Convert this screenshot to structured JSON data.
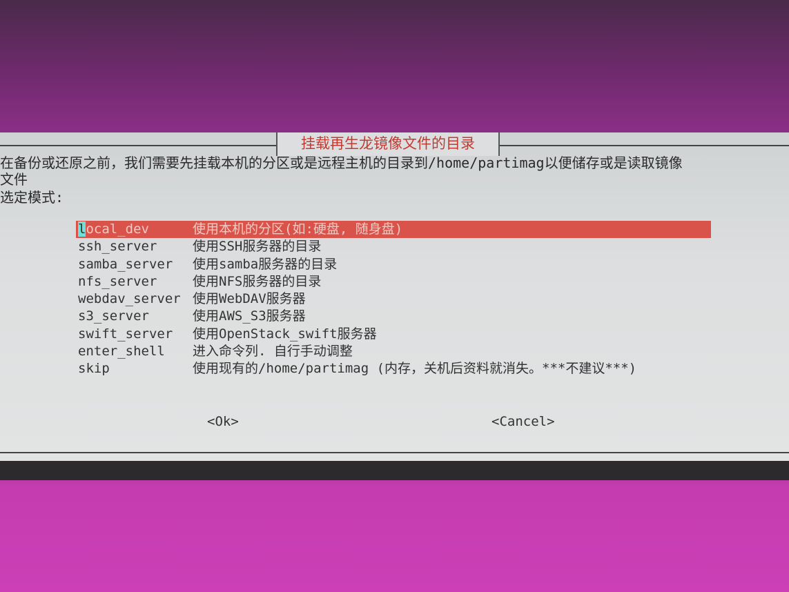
{
  "dialog": {
    "title": "挂载再生龙镜像文件的目录",
    "description_line1": "在备份或还原之前，我们需要先挂载本机的分区或是远程主机的目录到/home/partimag以便储存或是读取镜像",
    "description_line2": "文件",
    "prompt": "选定模式:",
    "options": [
      {
        "tag": "local_dev",
        "desc": "使用本机的分区(如:硬盘, 随身盘)",
        "selected": true
      },
      {
        "tag": "ssh_server",
        "desc": "使用SSH服务器的目录"
      },
      {
        "tag": "samba_server",
        "desc": "使用samba服务器的目录"
      },
      {
        "tag": "nfs_server",
        "desc": "使用NFS服务器的目录"
      },
      {
        "tag": "webdav_server",
        "desc": "使用WebDAV服务器"
      },
      {
        "tag": "s3_server",
        "desc": "使用AWS_S3服务器"
      },
      {
        "tag": "swift_server",
        "desc": "使用OpenStack_swift服务器"
      },
      {
        "tag": "enter_shell",
        "desc": "进入命令列. 自行手动调整"
      },
      {
        "tag": "skip",
        "desc": "使用现有的/home/partimag (内存，关机后资料就消失。***不建议***)"
      }
    ],
    "ok_label": "<Ok>",
    "cancel_label": "<Cancel>",
    "colors": {
      "highlight": "#d9534a",
      "title": "#c23a30",
      "cursor": "#6ee0d8"
    }
  }
}
